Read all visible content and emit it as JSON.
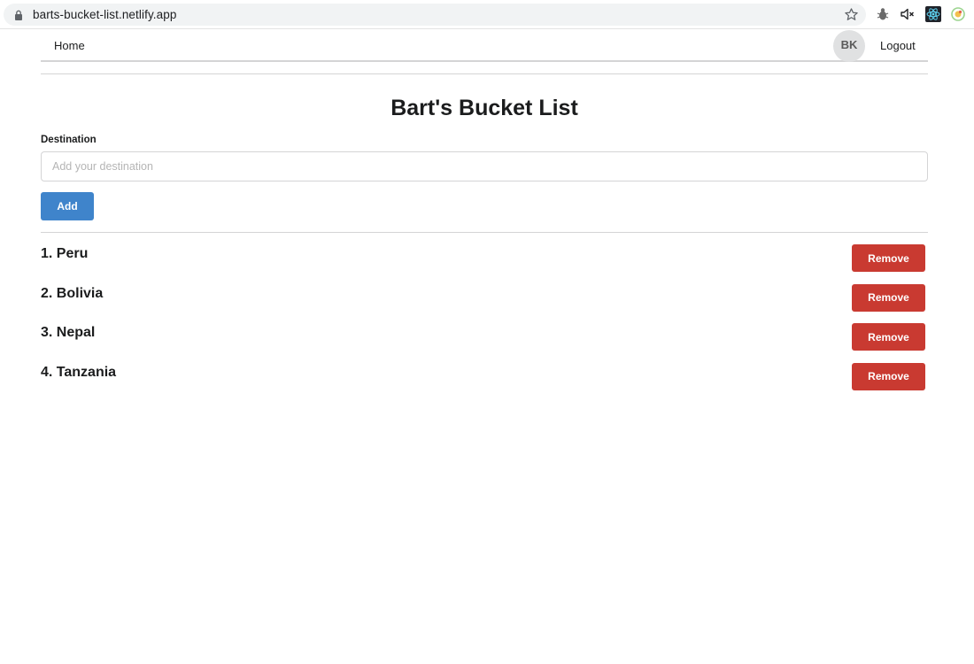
{
  "browser": {
    "url": "barts-bucket-list.netlify.app",
    "icons": [
      "lock-icon",
      "star-icon",
      "bug-extension-icon",
      "mute-icon",
      "react-devtools-icon",
      "extension-circle-icon"
    ]
  },
  "nav": {
    "home_label": "Home",
    "avatar_initials": "BK",
    "logout_label": "Logout"
  },
  "page": {
    "title": "Bart's Bucket List"
  },
  "form": {
    "label": "Destination",
    "input_value": "",
    "input_placeholder": "Add your destination",
    "add_label": "Add"
  },
  "destinations": [
    {
      "label": "1. Peru",
      "action": "Remove"
    },
    {
      "label": "2. Bolivia",
      "action": "Remove"
    },
    {
      "label": "3. Nepal",
      "action": "Remove"
    },
    {
      "label": "4. Tanzania",
      "action": "Remove"
    }
  ],
  "colors": {
    "primary": "#3f84cb",
    "danger": "#c93a31",
    "avatar_bg": "#e0e1e2"
  }
}
